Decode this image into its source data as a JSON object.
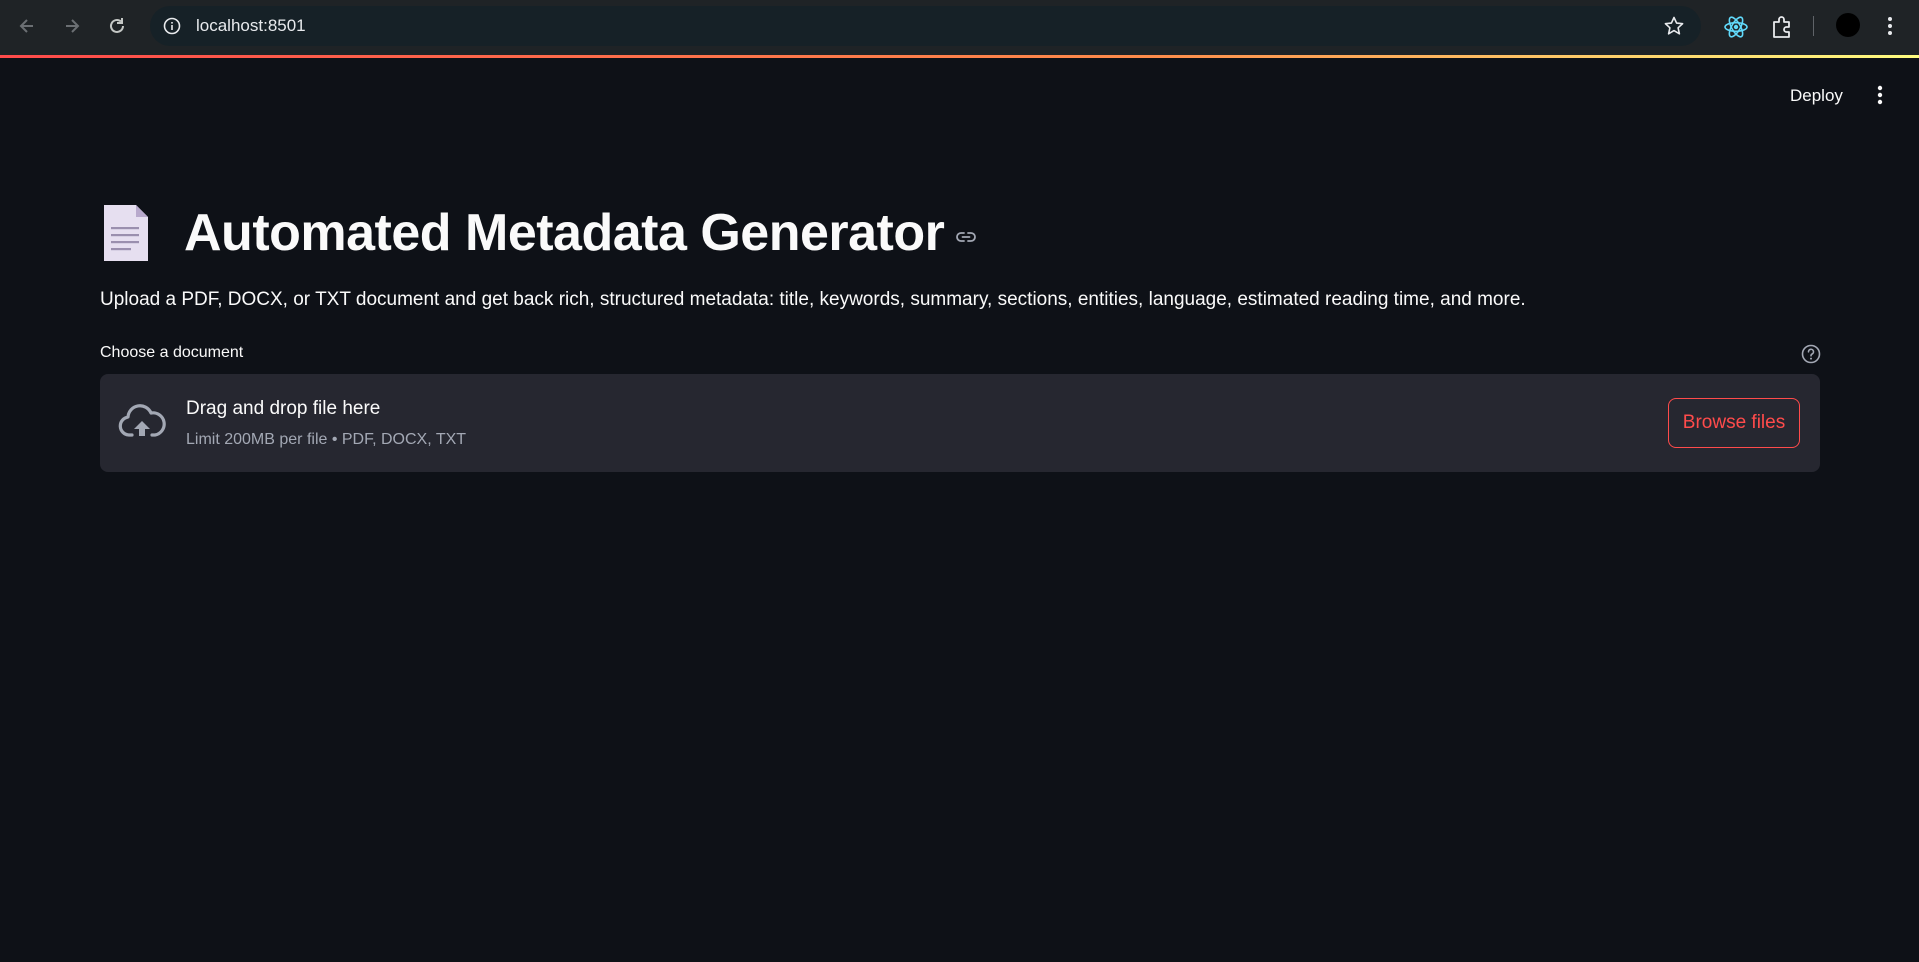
{
  "browser": {
    "url": "localhost:8501",
    "icons": [
      "back-icon",
      "forward-icon",
      "reload-icon",
      "site-info-icon",
      "bookmark-star-icon",
      "react-devtools-icon",
      "extensions-icon",
      "profile-avatar",
      "chrome-menu-icon"
    ]
  },
  "header": {
    "deploy_label": "Deploy"
  },
  "main": {
    "title": "Automated Metadata Generator",
    "subtitle": "Upload a PDF, DOCX, or TXT document and get back rich, structured metadata: title, keywords, summary, sections, entities, language, estimated reading time, and more.",
    "uploader": {
      "label": "Choose a document",
      "drop_title": "Drag and drop file here",
      "drop_subtitle": "Limit 200MB per file • PDF, DOCX, TXT",
      "browse_label": "Browse files"
    }
  },
  "colors": {
    "background": "#0e1117",
    "dropzone": "#262730",
    "accent": "#ff4b4b",
    "text": "#fafafa",
    "muted": "#a3a8b4"
  }
}
